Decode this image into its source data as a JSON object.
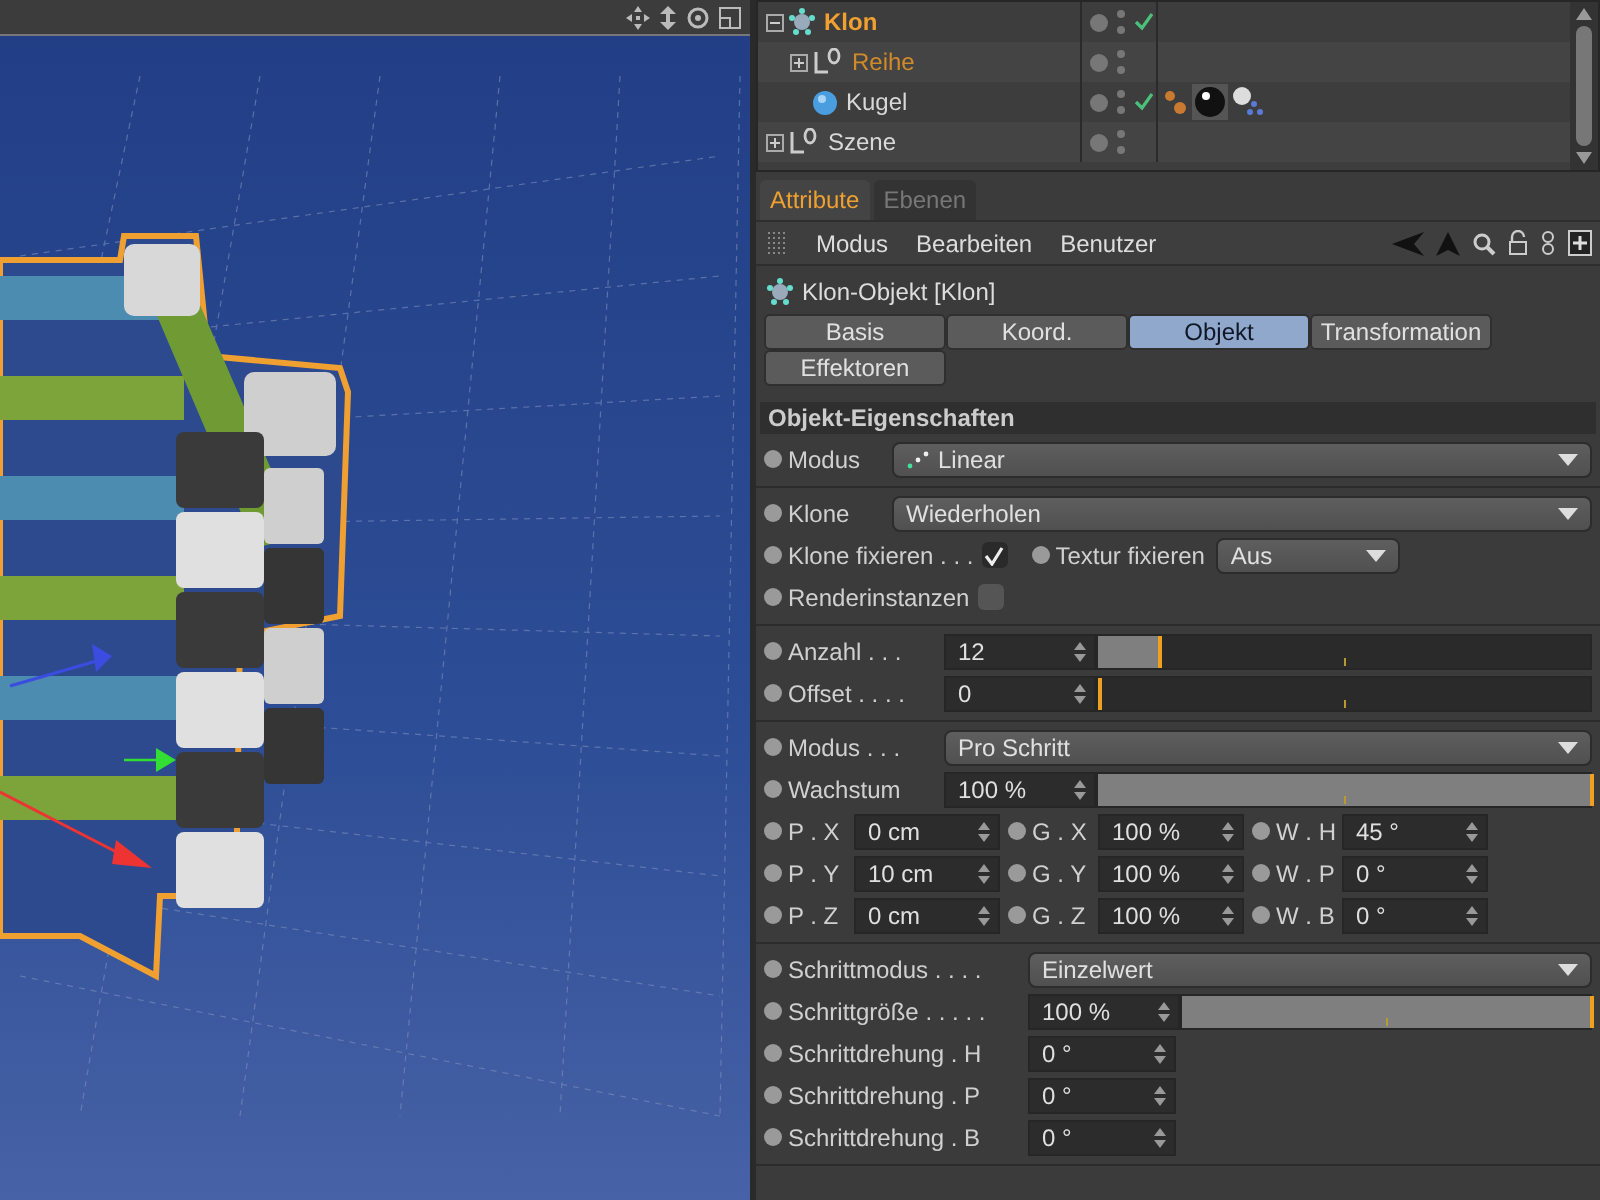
{
  "object_manager": {
    "items": [
      {
        "label": "Klon",
        "kind": "cloner",
        "selected": true,
        "highlighted": false,
        "expanded": true,
        "checked": true,
        "children": [
          {
            "label": "Reihe",
            "kind": "null",
            "selected": false,
            "highlighted": true,
            "expanded": false,
            "checked": false
          },
          {
            "label": "Kugel",
            "kind": "sphere",
            "selected": false,
            "highlighted": false,
            "checked": true,
            "tags": true
          }
        ]
      },
      {
        "label": "Szene",
        "kind": "null",
        "selected": false,
        "highlighted": false,
        "expanded": false,
        "checked": false
      }
    ]
  },
  "attribute_tabs": [
    {
      "label": "Attribute",
      "selected": true
    },
    {
      "label": "Ebenen",
      "selected": false
    }
  ],
  "menu": [
    "Modus",
    "Bearbeiten",
    "Benutzer"
  ],
  "title": "Klon-Objekt [Klon]",
  "property_tabs": [
    {
      "label": "Basis",
      "selected": false
    },
    {
      "label": "Koord.",
      "selected": false
    },
    {
      "label": "Objekt",
      "selected": true
    },
    {
      "label": "Transformation",
      "selected": false
    },
    {
      "label": "Effektoren",
      "selected": false
    }
  ],
  "section": "Objekt-Eigenschaften",
  "groups": [
    {
      "rows": [
        {
          "kind": "mode_dropdown",
          "label": "Modus",
          "value": "Linear"
        }
      ]
    },
    {
      "rows": [
        {
          "kind": "dropdown",
          "label": "Klone",
          "value": "Wiederholen"
        },
        {
          "kind": "checkbox_pair",
          "label": "Klone fixieren . . .",
          "checked": true,
          "label_2": "Textur fixieren",
          "value_2": "Aus"
        },
        {
          "kind": "checkbox",
          "label": "Renderinstanzen",
          "checked": false
        }
      ]
    },
    {
      "rows": [
        {
          "kind": "slider",
          "label": "Anzahl . . .",
          "value": "12",
          "level": 0.12
        },
        {
          "kind": "slider",
          "label": "Offset . . . .",
          "value": "0",
          "level": 0
        }
      ]
    },
    {
      "rows": [
        {
          "kind": "dropdown",
          "label": "Modus . . .",
          "value": "Pro Schritt"
        },
        {
          "kind": "slider",
          "label": "Wachstum",
          "value": "100 %",
          "level": 1
        },
        {
          "kind": "vector",
          "fields": [
            {
              "label": "P . X",
              "value": "0 cm"
            },
            {
              "label": "G . X",
              "value": "100 %"
            },
            {
              "label": "W . H",
              "value": "45 °"
            }
          ]
        },
        {
          "kind": "vector",
          "fields": [
            {
              "label": "P . Y",
              "value": "10 cm"
            },
            {
              "label": "G . Y",
              "value": "100 %"
            },
            {
              "label": "W . P",
              "value": "0 °"
            }
          ]
        },
        {
          "kind": "vector",
          "fields": [
            {
              "label": "P . Z",
              "value": "0 cm"
            },
            {
              "label": "G . Z",
              "value": "100 %"
            },
            {
              "label": "W . B",
              "value": "0 °"
            }
          ]
        }
      ]
    },
    {
      "rows": [
        {
          "kind": "dropdown",
          "label": "Schrittmodus . . . .",
          "value": "Einzelwert"
        },
        {
          "kind": "slider",
          "label": "Schrittgröße . . . . .",
          "value": "100 %",
          "level": 1
        },
        {
          "kind": "number",
          "label": "Schrittdrehung . H",
          "value": "0 °"
        },
        {
          "kind": "number",
          "label": "Schrittdrehung . P",
          "value": "0 °"
        },
        {
          "kind": "number",
          "label": "Schrittdrehung . B",
          "value": "0 °"
        }
      ]
    }
  ]
}
